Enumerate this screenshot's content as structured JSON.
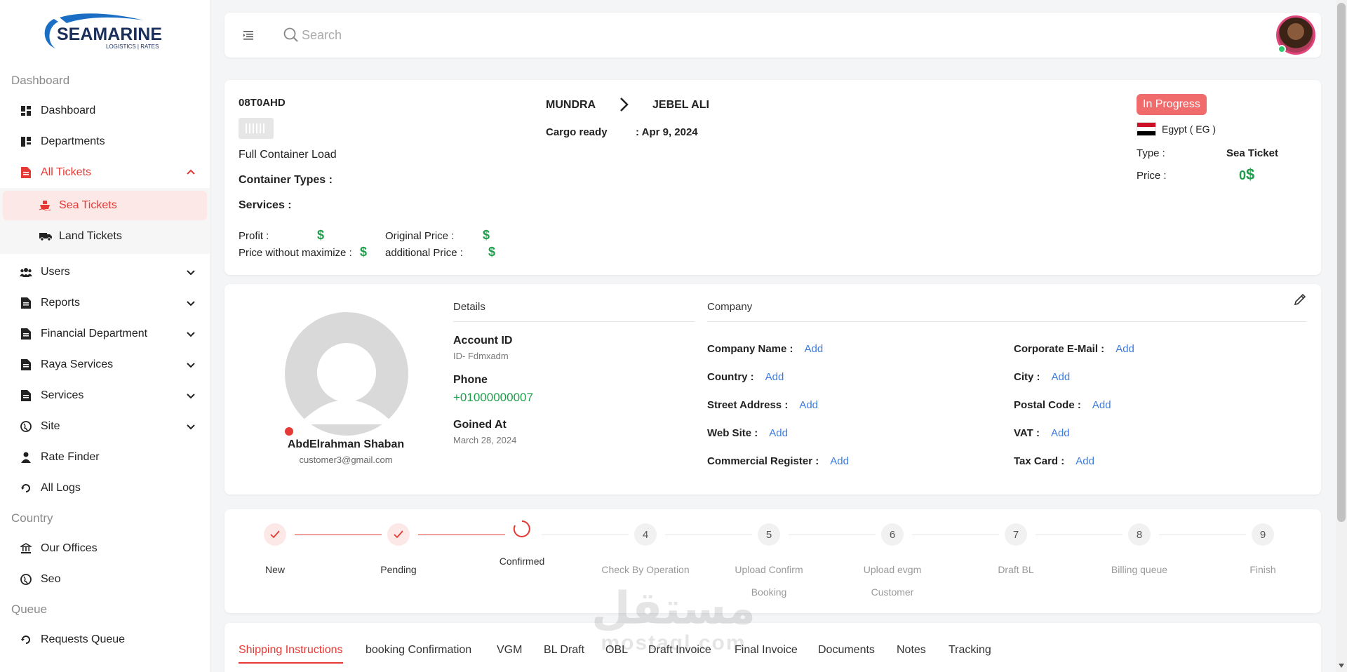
{
  "brand": {
    "name": "SEAMARINE",
    "tagline": "LOGISTICS | RATES",
    "accent": "#e53935",
    "green": "#1e9e4a",
    "link": "#3d7be0"
  },
  "sidebar": {
    "sections": {
      "dashboard": "Dashboard",
      "country": "Country",
      "queue": "Queue"
    },
    "items": {
      "dashboard": "Dashboard",
      "departments": "Departments",
      "all_tickets": "All Tickets",
      "sea_tickets": "Sea Tickets",
      "land_tickets": "Land Tickets",
      "users": "Users",
      "reports": "Reports",
      "financial": "Financial Department",
      "raya": "Raya Services",
      "services": "Services",
      "site": "Site",
      "rate_finder": "Rate Finder",
      "all_logs": "All Logs",
      "our_offices": "Our Offices",
      "seo": "Seo",
      "requests_queue": "Requests Queue"
    }
  },
  "topbar": {
    "search_placeholder": "Search"
  },
  "ticket": {
    "id": "08T0AHD",
    "load_type": "Full Container Load",
    "container_types_label": "Container Types :",
    "services_label": "Services :",
    "profit_label": "Profit :",
    "price_without_max_label": "Price without maximize :",
    "original_price_label": "Original Price :",
    "additional_price_label": "additional Price :",
    "currency": "$",
    "from": "MUNDRA",
    "to": "JEBEL ALI",
    "cargo_ready_label": "Cargo ready",
    "cargo_ready_value": ": Apr 9, 2024",
    "status": "In Progress",
    "country": "Egypt ( EG )",
    "type_label": "Type :",
    "type_value": "Sea Ticket",
    "price_label": "Price :",
    "price_value": "0",
    "price_currency": "$"
  },
  "customer": {
    "name": "AbdElrahman Shaban",
    "email": "customer3@gmail.com",
    "details_header": "Details",
    "account_id_label": "Account ID",
    "account_id_value": "ID- Fdmxadm",
    "phone_label": "Phone",
    "phone_value": "+01000000007",
    "joined_label": "Goined At",
    "joined_value": "March 28, 2024",
    "company_header": "Company",
    "add_text": "Add",
    "fields": {
      "company_name": "Company Name :",
      "corporate_email": "Corporate E-Mail :",
      "country": "Country :",
      "city": "City :",
      "street": "Street Address :",
      "postal": "Postal Code :",
      "website": "Web Site :",
      "vat": "VAT :",
      "commercial": "Commercial Register :",
      "tax_card": "Tax Card :"
    }
  },
  "stepper": {
    "steps": [
      {
        "num": "",
        "label": "New"
      },
      {
        "num": "",
        "label": "Pending"
      },
      {
        "num": "",
        "label": "Confirmed"
      },
      {
        "num": "4",
        "label": "Check By Operation"
      },
      {
        "num": "5",
        "label": "Upload Confirm Booking"
      },
      {
        "num": "6",
        "label": "Upload evgm Customer"
      },
      {
        "num": "7",
        "label": "Draft BL"
      },
      {
        "num": "8",
        "label": "Billing queue"
      },
      {
        "num": "9",
        "label": "Finish"
      }
    ]
  },
  "tabs": [
    "Shipping Instructions",
    "booking Confirmation",
    "VGM",
    "BL Draft",
    "OBL",
    "Draft Invoice",
    "Final Invoice",
    "Documents",
    "Notes",
    "Tracking"
  ],
  "watermark": {
    "arabic": "مستقل",
    "latin": "mostaql.com"
  }
}
